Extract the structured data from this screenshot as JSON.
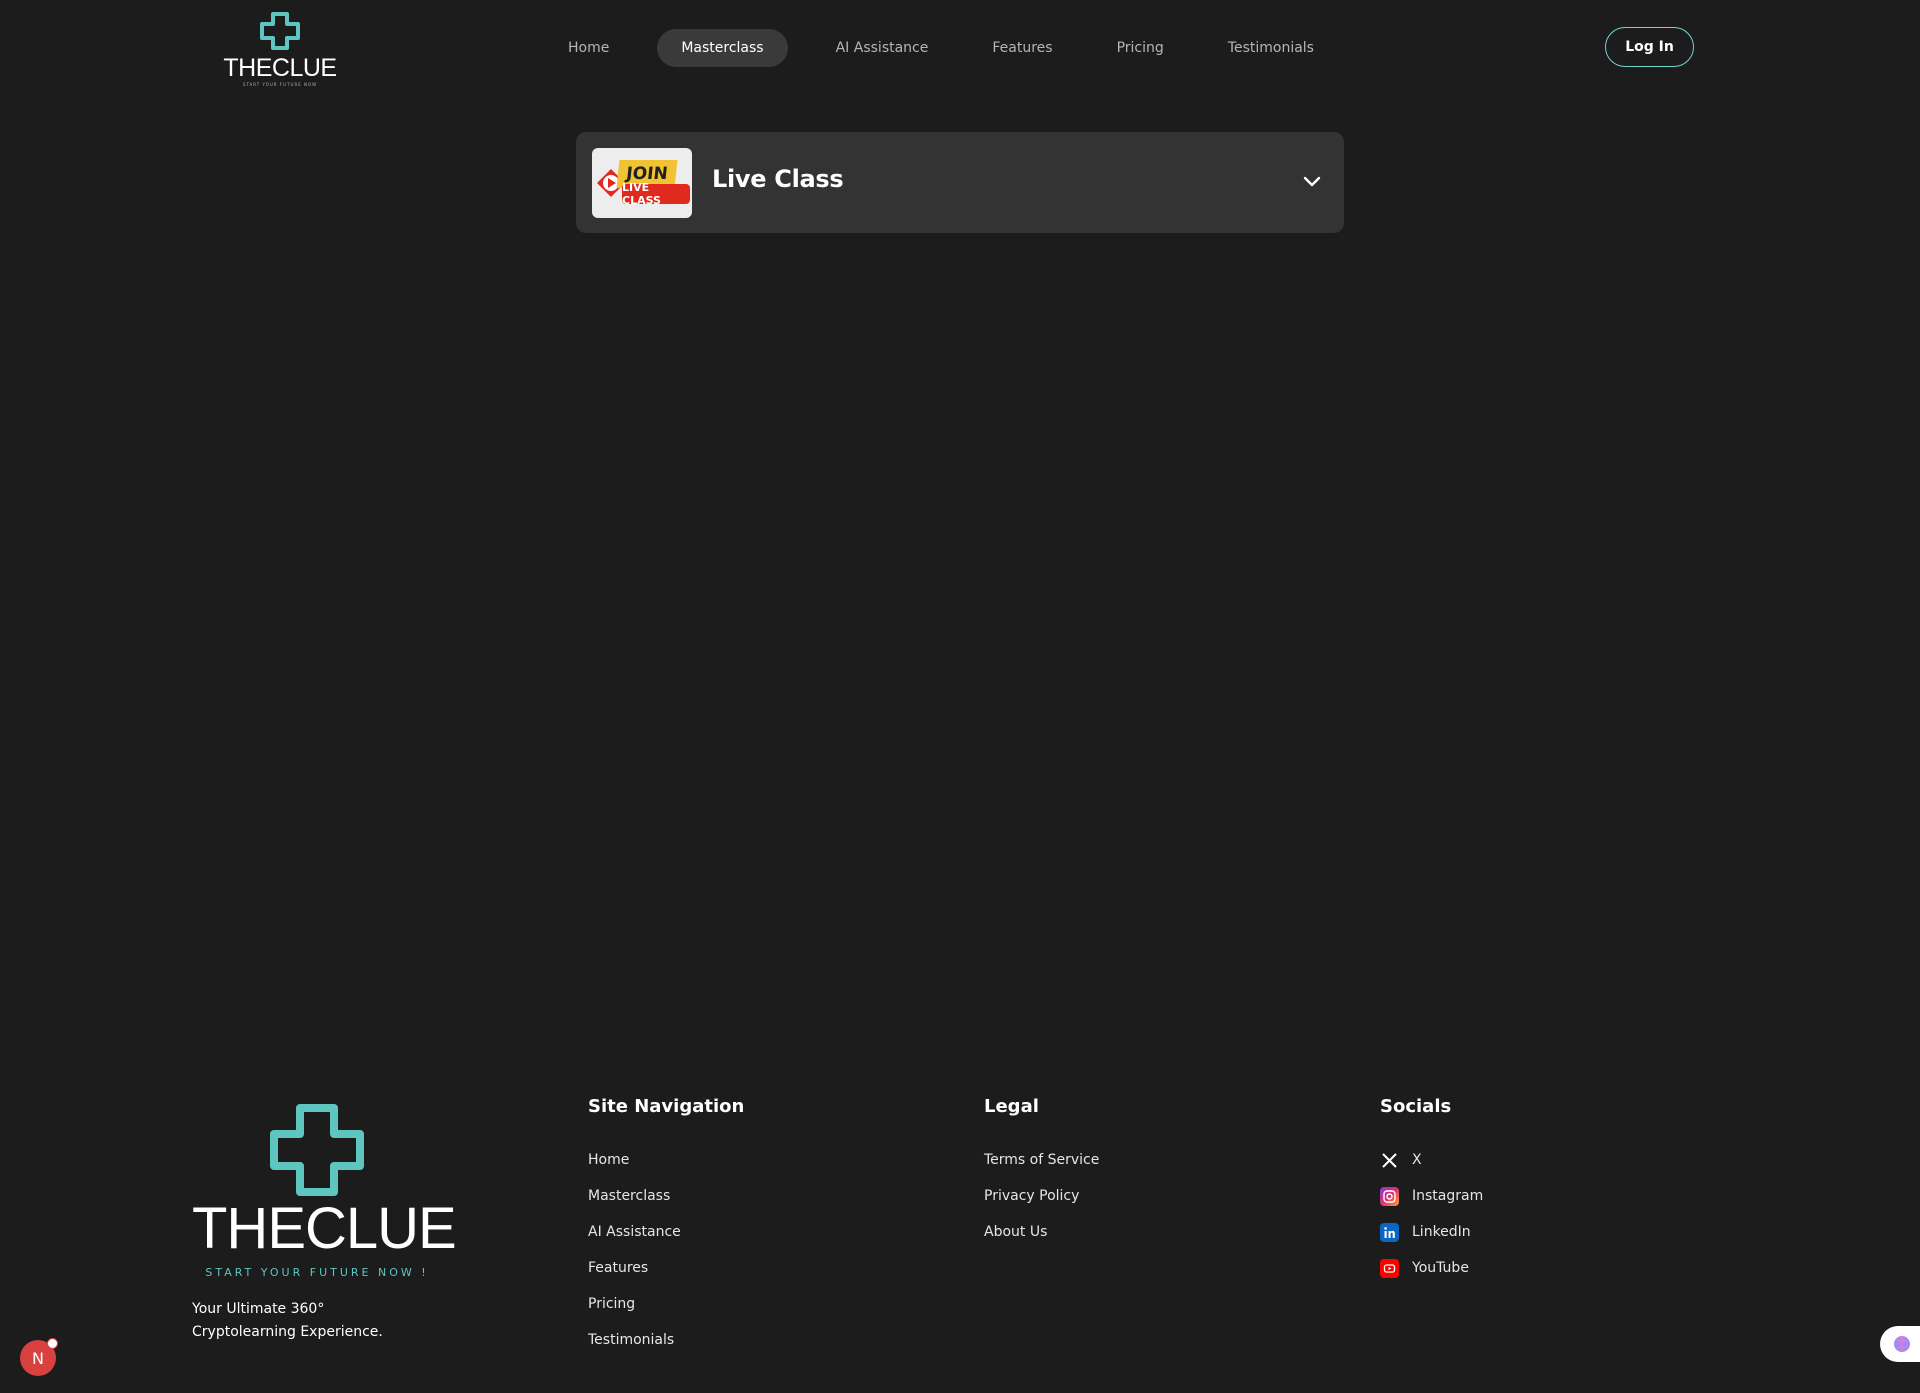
{
  "brand": {
    "name": "THECLUE",
    "tagline_small": "START YOUR FUTURE NOW",
    "accent_color": "#5fc5c1"
  },
  "nav": {
    "items": [
      "Home",
      "Masterclass",
      "AI Assistance",
      "Features",
      "Pricing",
      "Testimonials"
    ],
    "active": "Masterclass",
    "login_label": "Log In"
  },
  "live_class": {
    "thumb_join": "JOIN",
    "thumb_live": "LIVE CLASS",
    "title": "Live Class",
    "expand_icon": "chevron-down-icon"
  },
  "footer": {
    "logo_name": "THECLUE",
    "logo_tagline": "START YOUR FUTURE NOW !",
    "tagline_line1": "Your Ultimate 360°",
    "tagline_line2": "Cryptolearning Experience.",
    "site_nav": {
      "heading": "Site Navigation",
      "links": [
        "Home",
        "Masterclass",
        "AI Assistance",
        "Features",
        "Pricing",
        "Testimonials"
      ]
    },
    "legal": {
      "heading": "Legal",
      "links": [
        "Terms of Service",
        "Privacy Policy",
        "About Us"
      ]
    },
    "socials": {
      "heading": "Socials",
      "links": [
        {
          "label": "X",
          "icon": "x-icon"
        },
        {
          "label": "Instagram",
          "icon": "instagram-icon"
        },
        {
          "label": "LinkedIn",
          "icon": "linkedin-icon"
        },
        {
          "label": "YouTube",
          "icon": "youtube-icon"
        }
      ]
    }
  },
  "widgets": {
    "notification_letter": "N",
    "assistant_icon": "brain-icon"
  }
}
